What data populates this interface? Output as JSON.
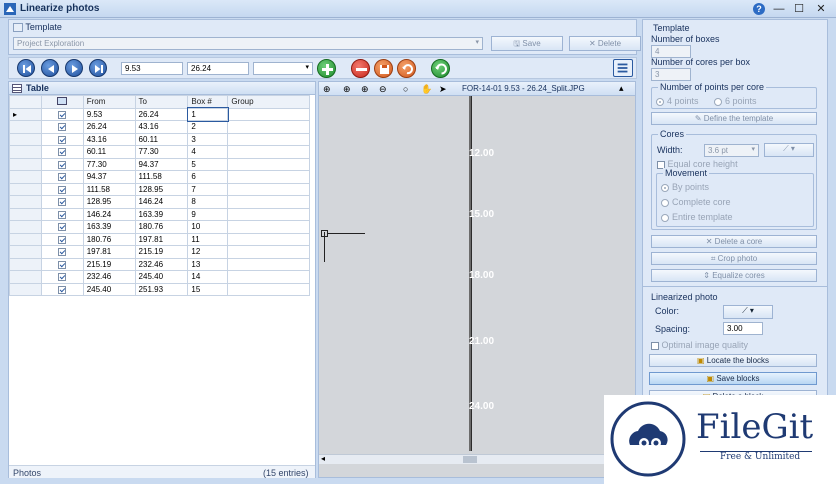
{
  "window": {
    "title": "Linearize photos",
    "help_glyph": "?",
    "min_glyph": "—",
    "max_glyph": "☐",
    "close_glyph": "✕"
  },
  "template_bar": {
    "label": "Template",
    "value": "Project Exploration",
    "save_label": "Save",
    "delete_label": "Delete"
  },
  "toolbar": {
    "from_value": "9.53",
    "to_value": "26.24",
    "group_value": ""
  },
  "table": {
    "title": "Table",
    "columns": [
      "From",
      "To",
      "Box #",
      "Group"
    ],
    "rows": [
      {
        "from": "9.53",
        "to": "26.24",
        "box": "1",
        "group": ""
      },
      {
        "from": "26.24",
        "to": "43.16",
        "box": "2",
        "group": ""
      },
      {
        "from": "43.16",
        "to": "60.11",
        "box": "3",
        "group": ""
      },
      {
        "from": "60.11",
        "to": "77.30",
        "box": "4",
        "group": ""
      },
      {
        "from": "77.30",
        "to": "94.37",
        "box": "5",
        "group": ""
      },
      {
        "from": "94.37",
        "to": "111.58",
        "box": "6",
        "group": ""
      },
      {
        "from": "111.58",
        "to": "128.95",
        "box": "7",
        "group": ""
      },
      {
        "from": "128.95",
        "to": "146.24",
        "box": "8",
        "group": ""
      },
      {
        "from": "146.24",
        "to": "163.39",
        "box": "9",
        "group": ""
      },
      {
        "from": "163.39",
        "to": "180.76",
        "box": "10",
        "group": ""
      },
      {
        "from": "180.76",
        "to": "197.81",
        "box": "11",
        "group": ""
      },
      {
        "from": "197.81",
        "to": "215.19",
        "box": "12",
        "group": ""
      },
      {
        "from": "215.19",
        "to": "232.46",
        "box": "13",
        "group": ""
      },
      {
        "from": "232.46",
        "to": "245.40",
        "box": "14",
        "group": ""
      },
      {
        "from": "245.40",
        "to": "251.93",
        "box": "15",
        "group": ""
      }
    ],
    "footer_left": "Photos",
    "footer_right": "(15 entries)"
  },
  "viewer": {
    "filename": "FOR-14-01 9.53 - 26.24_Split.JPG",
    "depth_ticks": [
      "12.00",
      "15.00",
      "18.00",
      "21.00",
      "24.00"
    ]
  },
  "right_panel": {
    "template_section": "Template",
    "num_boxes_label": "Number of boxes",
    "num_boxes_value": "4",
    "num_cores_label": "Number of cores per box",
    "num_cores_value": "3",
    "points_group": "Number of points per core",
    "points_4": "4 points",
    "points_6": "6 points",
    "define_template": "Define the template",
    "cores_group": "Cores",
    "width_label": "Width:",
    "width_value": "3.6 pt",
    "equal_core_height": "Equal core height",
    "movement_group": "Movement",
    "move_by_points": "By points",
    "move_complete_core": "Complete core",
    "move_entire_template": "Entire template",
    "delete_core": "Delete a core",
    "crop_photo": "Crop photo",
    "equalize_cores": "Equalize cores",
    "linearized_section": "Linearized photo",
    "color_label": "Color:",
    "spacing_label": "Spacing:",
    "spacing_value": "3.00",
    "optimal_quality": "Optimal image quality",
    "locate_blocks": "Locate the blocks",
    "save_blocks": "Save blocks",
    "delete_block": "Delete a block"
  },
  "watermark": {
    "name": "FileGit",
    "tagline": "Free & Unlimited"
  },
  "colors": {
    "accent": "#1f4f9c",
    "panel": "#dfe9f7",
    "brand": "#1f3a73"
  }
}
